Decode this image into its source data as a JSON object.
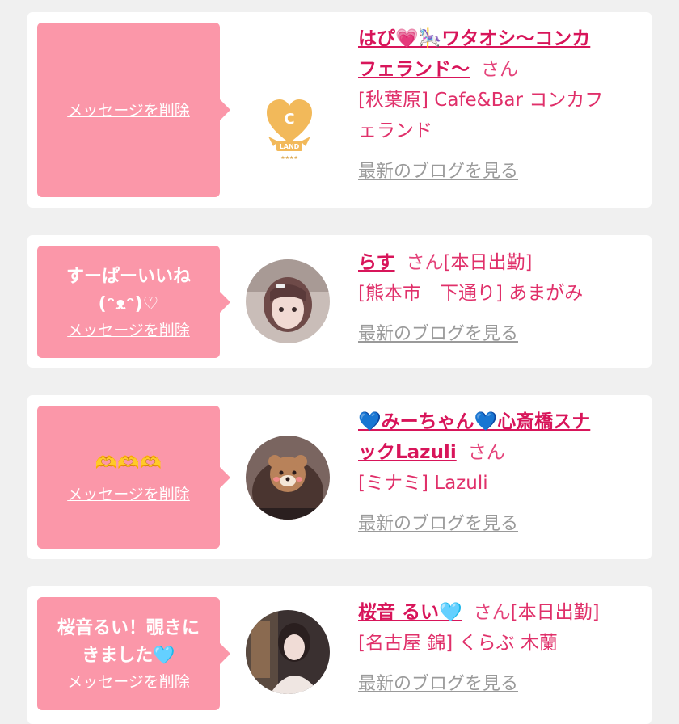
{
  "delete_label": "メッセージを削除",
  "blog_label": "最新のブログを見る",
  "san_label": "さん",
  "cards": [
    {
      "message": "",
      "name_line1": "はぴ💗🎠ワタオシ〜コンカ",
      "name_line2": "フェランド〜",
      "suffix": "",
      "shop_line1": "[秋葉原] Cafe&Bar コンカフ",
      "shop_line2": "ェランド",
      "logo_text": "LAND"
    },
    {
      "message": "すーぱーいいね\n(ᵔᴥᵔ)♡",
      "name_line1": "らす",
      "suffix": "[本日出勤]",
      "shop_line1": "[熊本市　下通り] あまがみ"
    },
    {
      "message": "🫶🫶🫶",
      "name_line1": "💙みーちゃん💙心斎橋スナ",
      "name_line2": "ックLazuli",
      "suffix": "",
      "shop_line1": "[ミナミ] Lazuli"
    },
    {
      "message": "桜音るい！覗きに\nきました🩵",
      "name_line1": "桜音 るい🩵",
      "suffix": "[本日出勤]",
      "shop_line1": "[名古屋 錦] くらぶ 木蘭"
    }
  ],
  "colors": {
    "bubble": "#fb97a9",
    "name": "#d8155a",
    "shop": "#e0306a",
    "blog": "#9a9a9a",
    "background": "#f0f0f0"
  }
}
